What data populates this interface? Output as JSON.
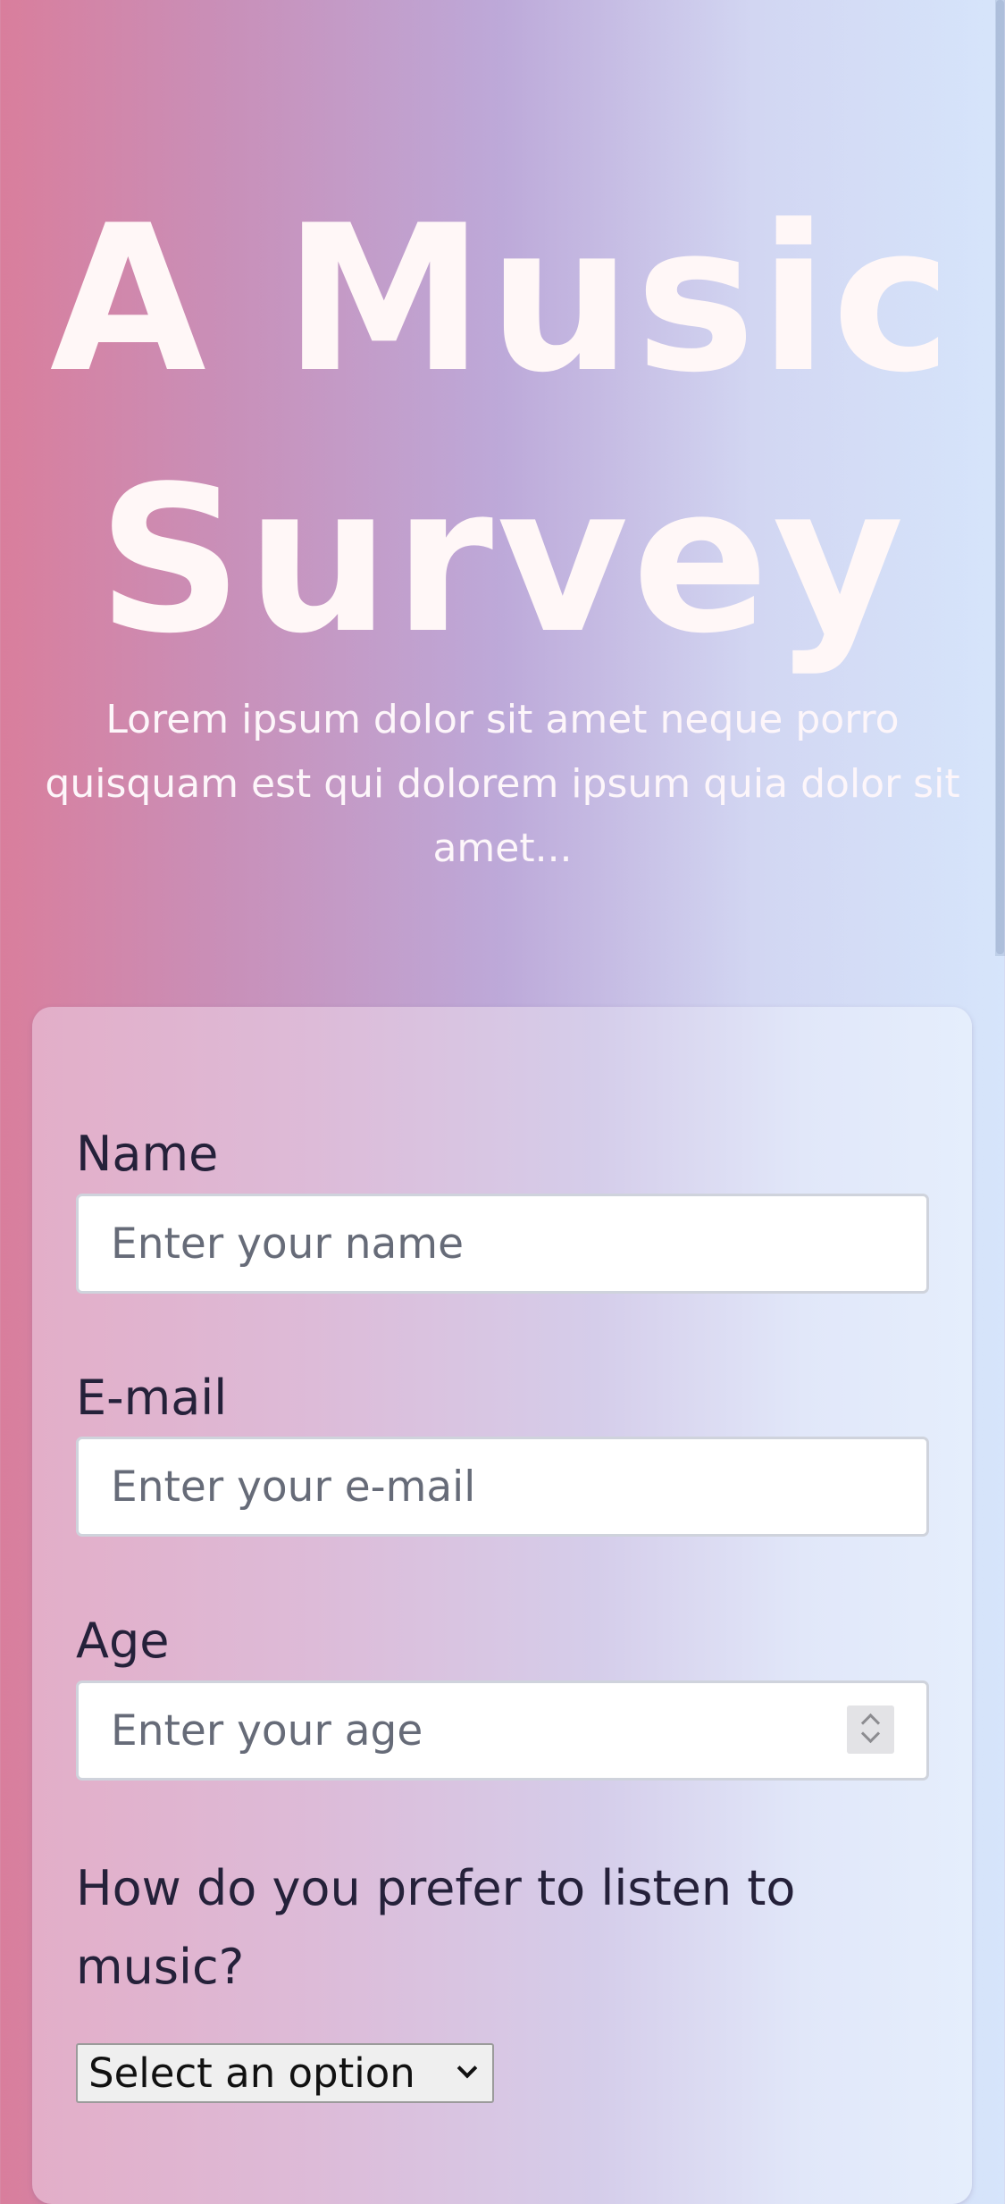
{
  "header": {
    "title": "A Music Survey",
    "description": "Lorem ipsum dolor sit amet neque porro quisquam est qui dolorem ipsum quia dolor sit amet..."
  },
  "form": {
    "name": {
      "label": "Name",
      "placeholder": "Enter your name"
    },
    "email": {
      "label": "E-mail",
      "placeholder": "Enter your e-mail"
    },
    "age": {
      "label": "Age",
      "placeholder": "Enter your age"
    },
    "listen": {
      "question": "How do you prefer to listen to music?",
      "selected": "Select an option"
    }
  },
  "icons": {
    "age_spinner": "spinner-icon",
    "select_arrow": "chevron-down-icon"
  },
  "colors": {
    "gradient_left": "#d97e9c",
    "gradient_mid": "#bda9d9",
    "gradient_right": "#d6e5fb",
    "title_text": "#fff7f7",
    "label_text": "#25213a"
  }
}
